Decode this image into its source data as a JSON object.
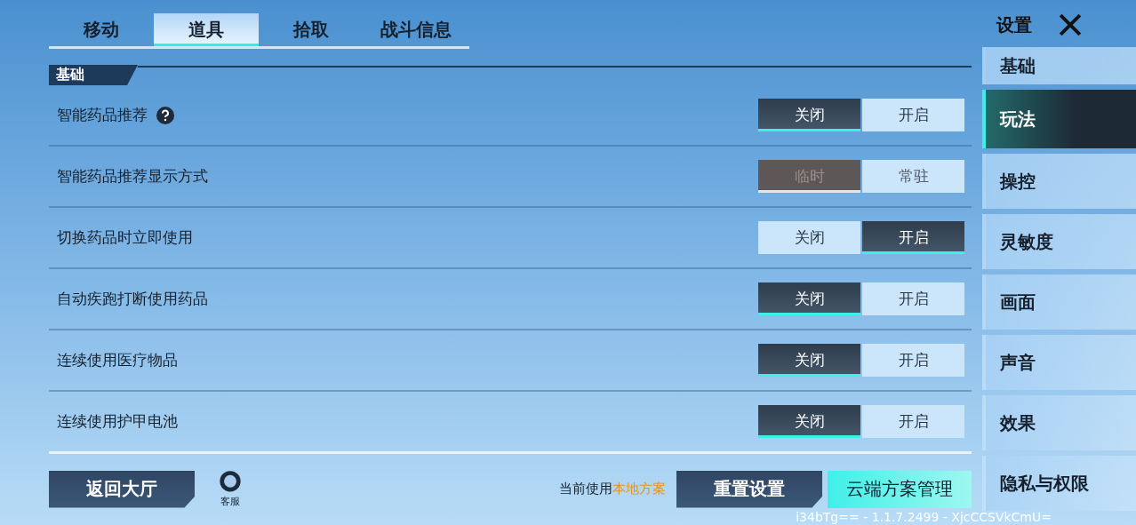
{
  "tabs": [
    {
      "label": "移动",
      "selected": false
    },
    {
      "label": "道具",
      "selected": true
    },
    {
      "label": "拾取",
      "selected": false
    },
    {
      "label": "战斗信息",
      "selected": false
    }
  ],
  "section": {
    "title": "基础"
  },
  "settings": [
    {
      "label": "智能药品推荐",
      "help": true,
      "disabled": false,
      "options": [
        {
          "label": "关闭",
          "selected": true
        },
        {
          "label": "开启",
          "selected": false
        }
      ]
    },
    {
      "label": "智能药品推荐显示方式",
      "help": false,
      "disabled": true,
      "options": [
        {
          "label": "临时",
          "selected": true
        },
        {
          "label": "常驻",
          "selected": false
        }
      ]
    },
    {
      "label": "切换药品时立即使用",
      "help": false,
      "disabled": false,
      "options": [
        {
          "label": "关闭",
          "selected": false
        },
        {
          "label": "开启",
          "selected": true
        }
      ]
    },
    {
      "label": "自动疾跑打断使用药品",
      "help": false,
      "disabled": false,
      "options": [
        {
          "label": "关闭",
          "selected": true
        },
        {
          "label": "开启",
          "selected": false
        }
      ]
    },
    {
      "label": "连续使用医疗物品",
      "help": false,
      "disabled": false,
      "options": [
        {
          "label": "关闭",
          "selected": true
        },
        {
          "label": "开启",
          "selected": false
        }
      ]
    },
    {
      "label": "连续使用护甲电池",
      "help": false,
      "disabled": false,
      "options": [
        {
          "label": "关闭",
          "selected": true
        },
        {
          "label": "开启",
          "selected": false
        }
      ]
    }
  ],
  "footer": {
    "back": "返回大厅",
    "service": "客服",
    "scheme_prefix": "当前使用",
    "scheme": "本地方案",
    "reset": "重置设置",
    "cloud": "云端方案管理",
    "version": "i34bTg== - 1.1.7.2499 - XjcCCSVkCmU="
  },
  "sidebar": {
    "title": "设置",
    "items": [
      {
        "label": "基础",
        "selected": false
      },
      {
        "label": "玩法",
        "selected": true
      },
      {
        "label": "操控",
        "selected": false
      },
      {
        "label": "灵敏度",
        "selected": false
      },
      {
        "label": "画面",
        "selected": false
      },
      {
        "label": "声音",
        "selected": false
      },
      {
        "label": "效果",
        "selected": false
      },
      {
        "label": "隐私与权限",
        "selected": false
      }
    ]
  }
}
